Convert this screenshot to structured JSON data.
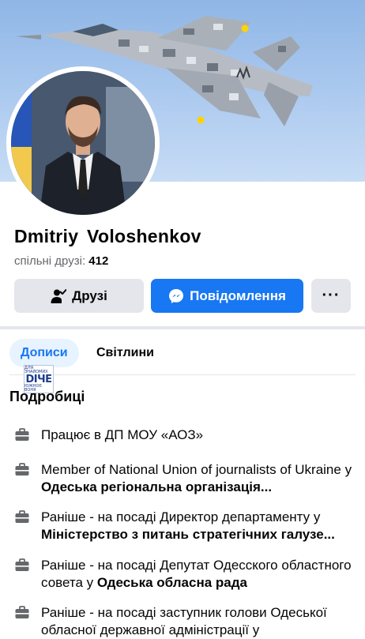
{
  "profile": {
    "name": "Dmitriy  Voloshenkov",
    "mutual_friends_label": "спільні друзі:",
    "mutual_friends_count": "412"
  },
  "actions": {
    "friends_label": "Друзі",
    "message_label": "Повідомлення",
    "more_label": "···"
  },
  "tabs": {
    "posts": "Дописи",
    "photos": "Світлини"
  },
  "watermark": {
    "top": "ДЛЯ ЗНАЙОМИХ",
    "main": "DIЧЕ",
    "bottom": "ЮЖНОЄ ВОНЯ"
  },
  "details": {
    "title": "Подробиці",
    "items": [
      {
        "text": "Працює в ДП МОУ «АОЗ»",
        "place": ""
      },
      {
        "text": "Member of National Union of journalists of Ukraine у ",
        "place": "Одеська регіональна організація..."
      },
      {
        "text": "Раніше - на посаді Директор департаменту у ",
        "place": "Міністерство з питань стратегічних галузе..."
      },
      {
        "text": "Раніше - на посаді Депутат Одесского областного совета у ",
        "place": "Одеська обласна рада"
      },
      {
        "text": "Раніше - на посаді заступник голови Одеської обласної державної адміністрації у",
        "place": ""
      }
    ]
  },
  "colors": {
    "accent": "#1877f2",
    "button_gray": "#e4e6eb",
    "secondary_text": "#65676b"
  },
  "icons": {
    "friends": "person-check-icon",
    "message": "messenger-icon",
    "work": "briefcase-icon"
  }
}
